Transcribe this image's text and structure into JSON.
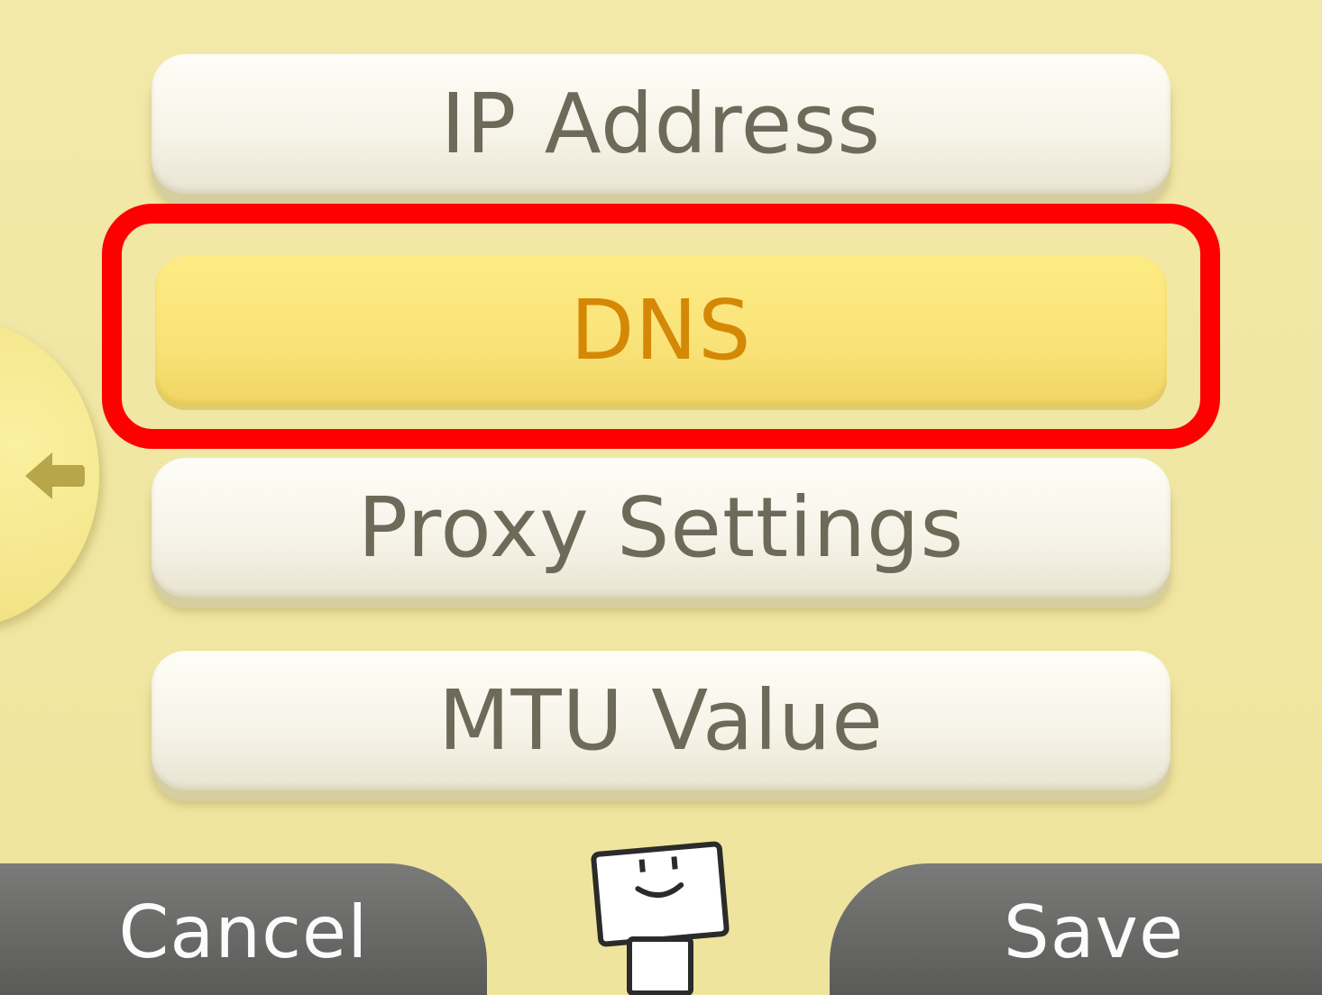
{
  "menu": {
    "items": [
      {
        "label": "IP Address",
        "selected": false
      },
      {
        "label": "DNS",
        "selected": true
      },
      {
        "label": "Proxy Settings",
        "selected": false
      },
      {
        "label": "MTU Value",
        "selected": false
      }
    ]
  },
  "bottom_bar": {
    "cancel_label": "Cancel",
    "save_label": "Save"
  },
  "icons": {
    "back": "arrow-left-icon",
    "mascot": "smiley-robot-icon"
  },
  "colors": {
    "background": "#f1e7a6",
    "selected_button": "#fae47a",
    "selected_text": "#d48806",
    "button_text": "#6e6a5a",
    "highlight_frame": "#ff0000",
    "bottom_bar": "#6a6a68"
  }
}
